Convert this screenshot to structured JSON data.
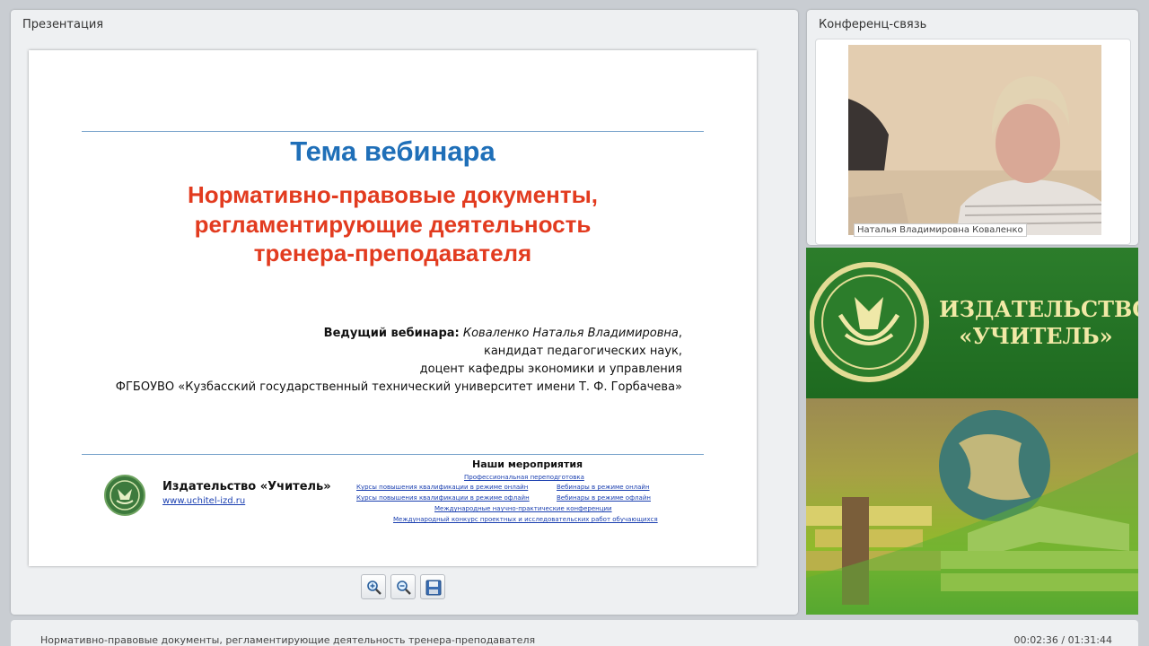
{
  "presentation_panel": {
    "title": "Презентация"
  },
  "slide": {
    "heading": "Тема вебинара",
    "topic": "Нормативно-правовые документы, регламентирующие деятельность тренера-преподавателя",
    "presenter_label": "Ведущий вебинара:",
    "presenter_name": "Коваленко Наталья Владимировна",
    "presenter_degree": "кандидат педагогических наук,",
    "presenter_position": "доцент кафедры экономики и управления",
    "presenter_org": "ФГБОУВО «Кузбасский государственный технический университет имени Т. Ф. Горбачева»",
    "publisher_name": "Издательство «Учитель»",
    "publisher_url": "www.uchitel-izd.ru",
    "events_title": "Наши мероприятия",
    "events": [
      "Профессиональная переподготовка",
      "Курсы повышения квалификации в режиме онлайн",
      "Вебинары в режиме онлайн",
      "Курсы повышения квалификации в режиме офлайн",
      "Вебинары в режиме офлайн",
      "Международные научно-практические конференции",
      "Международный конкурс проектных и исследовательских работ обучающихся"
    ]
  },
  "toolbar": {
    "zoom_in_icon": "zoom-in-icon",
    "zoom_out_icon": "zoom-out-icon",
    "save_icon": "save-icon"
  },
  "conference_panel": {
    "title": "Конференц-связь",
    "participant_name": "Наталья Владимировна Коваленко"
  },
  "brand": {
    "line1": "ИЗДАТЕЛЬСТВО",
    "line2": "«УЧИТЕЛЬ»"
  },
  "status_bar": {
    "title": "Нормативно-правовые документы, регламентирующие деятельность тренера-преподавателя",
    "time": "00:02:36 / 01:31:44"
  },
  "colors": {
    "heading": "#1f6fb8",
    "topic": "#e23b1f",
    "brand_green": "#2c7d2b",
    "brand_text": "#f1e9a6"
  }
}
